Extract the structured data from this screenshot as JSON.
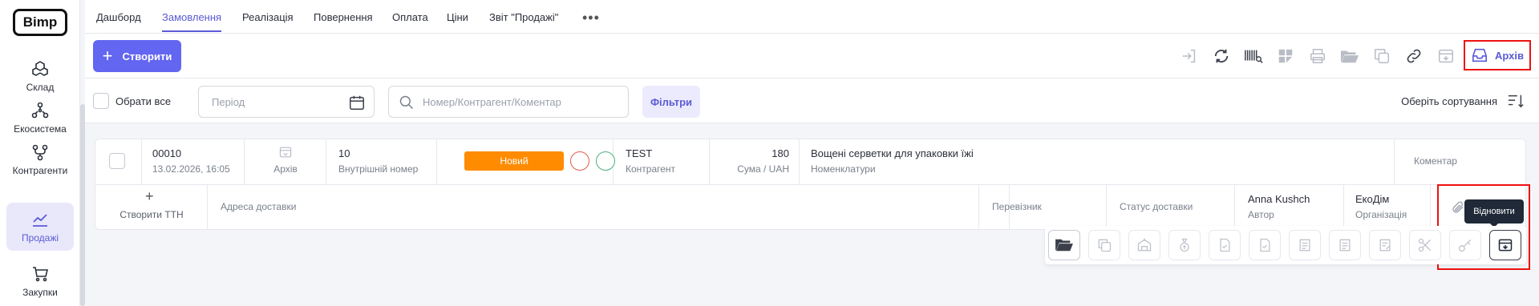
{
  "app": {
    "logo_text": "Bimp"
  },
  "sidebar": {
    "items": [
      {
        "label": "Склад",
        "icon": "warehouse-icon"
      },
      {
        "label": "Екосистема",
        "icon": "ecosystem-icon"
      },
      {
        "label": "Контрагенти",
        "icon": "contractors-icon"
      },
      {
        "label": "Продажі",
        "icon": "sales-icon",
        "active": true
      },
      {
        "label": "Закупки",
        "icon": "cart-icon"
      }
    ]
  },
  "topnav": {
    "tabs": [
      {
        "label": "Дашборд"
      },
      {
        "label": "Замовлення",
        "active": true
      },
      {
        "label": "Реалізація"
      },
      {
        "label": "Повернення"
      },
      {
        "label": "Оплата"
      },
      {
        "label": "Ціни"
      },
      {
        "label": "Звіт \"Продажі\""
      }
    ],
    "more": "•••"
  },
  "toolbar": {
    "create_label": "Створити",
    "archive_label": "Архів"
  },
  "filters": {
    "select_all": "Обрати все",
    "period_placeholder": "Період",
    "search_placeholder": "Номер/Контрагент/Коментар",
    "filters_label": "Фільтри",
    "sort_label": "Оберіть сортування"
  },
  "order": {
    "number": "00010",
    "datetime": "13.02.2026, 16:05",
    "archive_label": "Архів",
    "internal_number": "10",
    "internal_number_label": "Внутрішній номер",
    "status": "Новий",
    "contractor": "TEST",
    "contractor_label": "Контрагент",
    "sum": "180",
    "sum_label": "Сума / UAH",
    "product": "Вощені серветки для упаковки їжі",
    "product_label": "Номенклатури",
    "comment_label": "Коментар",
    "create_ttn": "Створити ТТН",
    "delivery_address": "Адреса доставки",
    "carrier": "Перевізник",
    "delivery_status": "Статус доставки",
    "author": "Anna Kushch",
    "author_label": "Автор",
    "org": "ЕкоДім",
    "org_label": "Організація"
  },
  "tooltip": {
    "restore": "Відновити"
  },
  "colors": {
    "accent": "#6366f1",
    "status_new": "#ff8c00",
    "highlight": "#ee1111"
  }
}
